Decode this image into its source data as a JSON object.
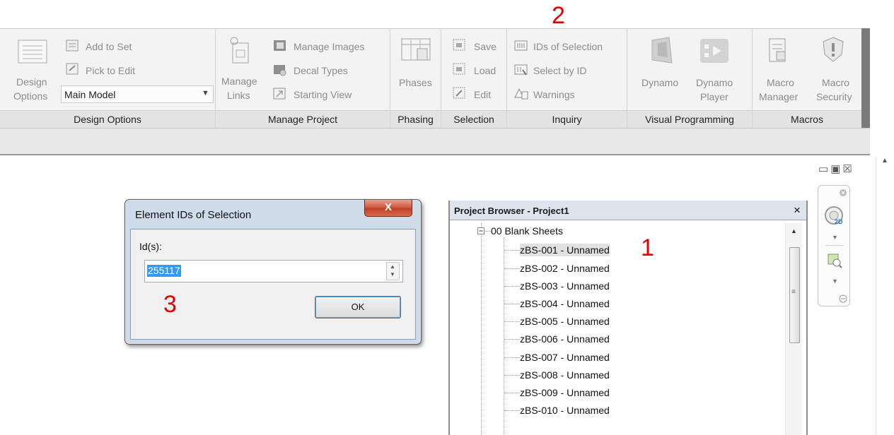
{
  "annotations": {
    "one": "1",
    "two": "2",
    "three": "3"
  },
  "ribbon": {
    "design_options": {
      "title": "Design Options",
      "design_line1": "Design",
      "design_line2": "Options",
      "add_to_set": "Add to Set",
      "pick_to_edit": "Pick to Edit",
      "dropdown_value": "Main Model"
    },
    "manage_project": {
      "title": "Manage Project",
      "manage_line1": "Manage",
      "manage_line2": "Links",
      "manage_images": "Manage Images",
      "decal_types": "Decal Types",
      "starting_view": "Starting View"
    },
    "phasing": {
      "title": "Phasing",
      "phases": "Phases"
    },
    "selection": {
      "title": "Selection",
      "save": "Save",
      "load": "Load",
      "edit": "Edit"
    },
    "inquiry": {
      "title": "Inquiry",
      "ids_of_selection": "IDs of Selection",
      "select_by_id": "Select by ID",
      "warnings": "Warnings"
    },
    "visual_programming": {
      "title": "Visual Programming",
      "dynamo": "Dynamo",
      "dynamo_player_line1": "Dynamo",
      "dynamo_player_line2": "Player"
    },
    "macros": {
      "title": "Macros",
      "manager_line1": "Macro",
      "manager_line2": "Manager",
      "security_line1": "Macro",
      "security_line2": "Security"
    }
  },
  "dialog": {
    "title": "Element IDs of Selection",
    "close": "X",
    "label": "Id(s):",
    "value": "255117",
    "ok": "OK"
  },
  "project_browser": {
    "title": "Project Browser - Project1",
    "close": "×",
    "root": "00 Blank Sheets",
    "items": [
      "zBS-001 - Unnamed",
      "zBS-002 - Unnamed",
      "zBS-003 - Unnamed",
      "zBS-004 - Unnamed",
      "zBS-005 - Unnamed",
      "zBS-006 - Unnamed",
      "zBS-007 - Unnamed",
      "zBS-008 - Unnamed",
      "zBS-009 - Unnamed",
      "zBS-010 - Unnamed"
    ]
  },
  "icons": {
    "minimize": "minimize-icon",
    "restore": "restore-icon",
    "close": "close-icon",
    "nav_2d": "2d-wheel-icon",
    "zoom_sheet": "zoom-sheet-icon"
  },
  "colors": {
    "annotation": "#e00000",
    "selection": "#3399ff",
    "dialog_close": "#c1402a"
  }
}
